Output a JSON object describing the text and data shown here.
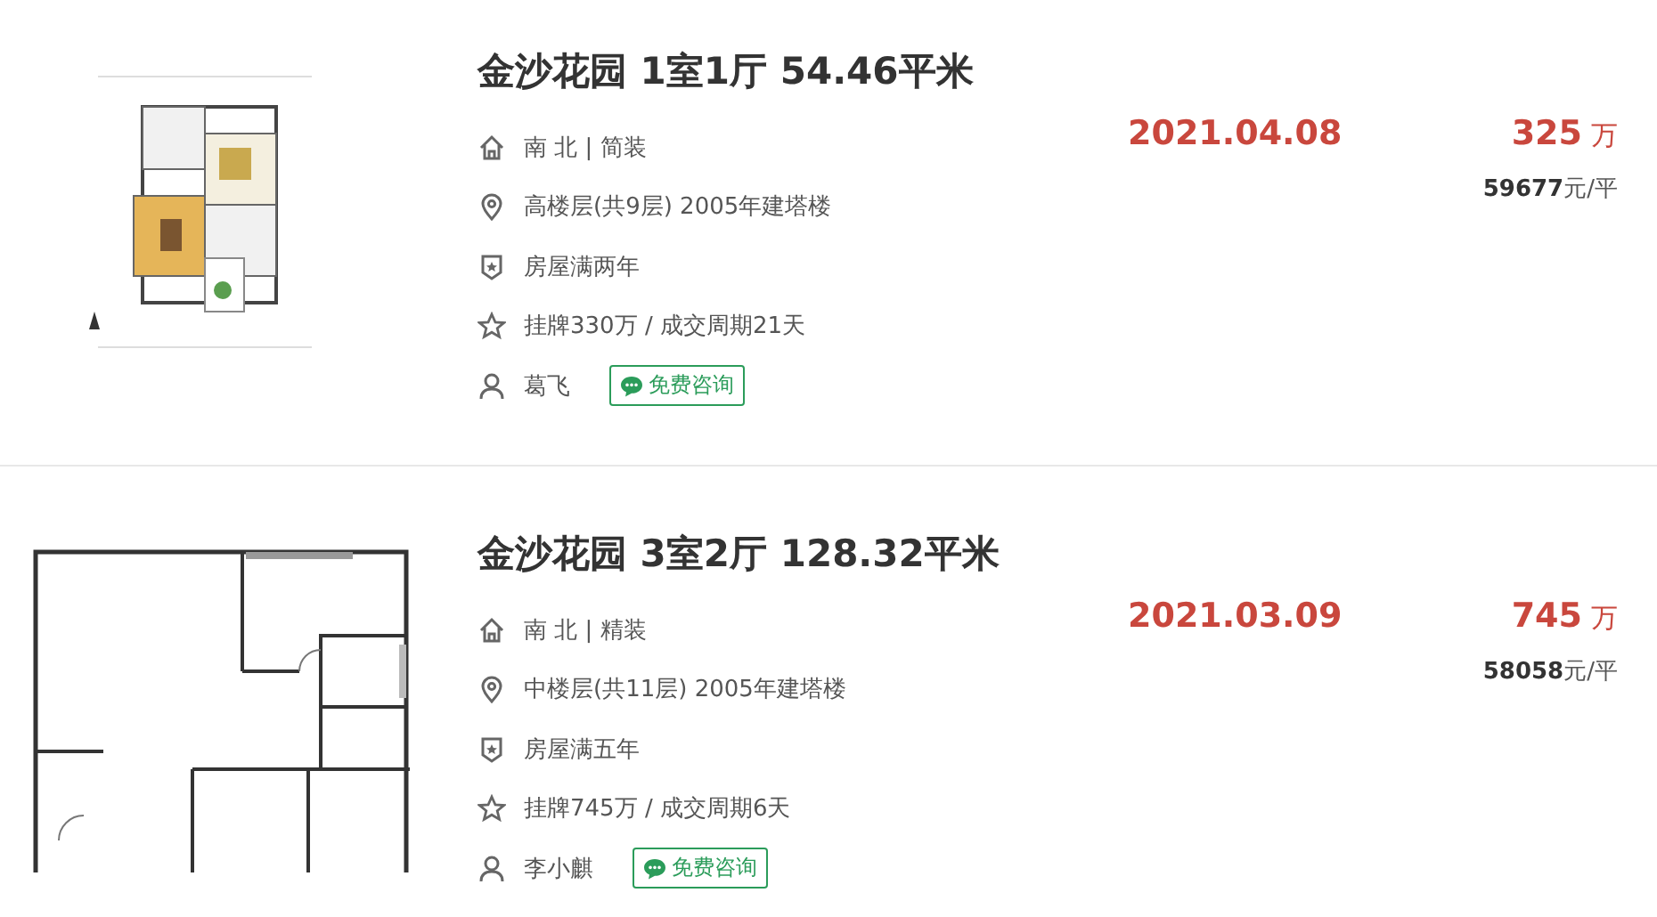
{
  "listings": [
    {
      "title": "金沙花园 1室1厅 54.46平米",
      "orientation": "南 北 | 简装",
      "floor": "高楼层(共9层) 2005年建塔楼",
      "ownership": "房屋满两年",
      "listing_info": "挂牌330万 / 成交周期21天",
      "agent": "葛飞",
      "consult_button": "免费咨询",
      "deal_date": "2021.04.08",
      "price": "325",
      "price_unit": "万",
      "unit_price": "**59677**元/平"
    },
    {
      "title": "金沙花园 3室2厅 128.32平米",
      "orientation": "南 北 | 精装",
      "floor": "中楼层(共11层) 2005年建塔楼",
      "ownership": "房屋满五年",
      "listing_info": "挂牌745万 / 成交周期6天",
      "agent": "李小麒",
      "consult_button": "免费咨询",
      "deal_date": "2021.03.09",
      "price": "745",
      "price_unit": "万",
      "unit_price": "**58058**元/平"
    }
  ]
}
